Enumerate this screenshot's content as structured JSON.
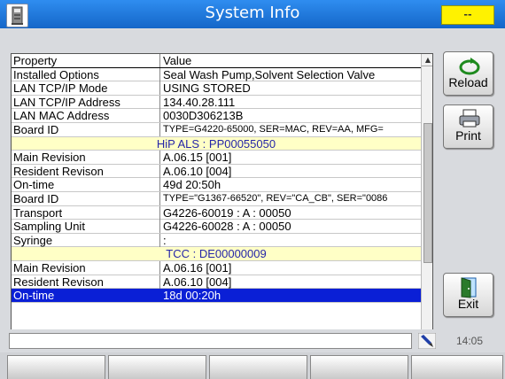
{
  "window": {
    "title": "System Info",
    "status_indicator": "--",
    "accent_color": "#1e74dc",
    "indicator_color": "#fff200"
  },
  "table": {
    "headers": [
      "Property",
      "Value"
    ],
    "rows": [
      {
        "type": "data",
        "property": "Installed Options",
        "value": "Seal Wash Pump,Solvent Selection Valve"
      },
      {
        "type": "data",
        "property": "LAN TCP/IP Mode",
        "value": "USING STORED"
      },
      {
        "type": "data",
        "property": "LAN TCP/IP Address",
        "value": "134.40.28.111"
      },
      {
        "type": "data",
        "property": "LAN MAC Address",
        "value": "0030D306213B"
      },
      {
        "type": "data",
        "property": "Board ID",
        "value": "TYPE=G4220-65000,  SER=MAC,  REV=AA,  MFG=",
        "small": true
      },
      {
        "type": "section",
        "label": "HiP ALS : PP00055050"
      },
      {
        "type": "data",
        "property": "Main Revision",
        "value": "A.06.15 [001]"
      },
      {
        "type": "data",
        "property": "Resident Revison",
        "value": "A.06.10 [004]"
      },
      {
        "type": "data",
        "property": "On-time",
        "value": "49d 20:50h"
      },
      {
        "type": "data",
        "property": "Board ID",
        "value": "TYPE=\"G1367-66520\", REV=\"CA_CB\", SER=\"0086",
        "small": true
      },
      {
        "type": "data",
        "property": "Transport",
        "value": "G4226-60019 : A : 00050"
      },
      {
        "type": "data",
        "property": "Sampling Unit",
        "value": "G4226-60028 : A : 00050"
      },
      {
        "type": "data",
        "property": "Syringe",
        "value": ":"
      },
      {
        "type": "section",
        "label": "TCC : DE00000009"
      },
      {
        "type": "data",
        "property": "Main Revision",
        "value": "A.06.16 [001]"
      },
      {
        "type": "data",
        "property": "Resident Revison",
        "value": "A.06.10 [004]"
      },
      {
        "type": "data",
        "property": "On-time",
        "value": "18d 00:20h",
        "selected": true
      }
    ]
  },
  "buttons": {
    "reload": "Reload",
    "print": "Print",
    "exit": "Exit"
  },
  "statusbar": {
    "message": "",
    "time": "14:05"
  },
  "icons": {
    "app": "instrument-icon",
    "reload": "reload-icon",
    "print": "printer-icon",
    "exit": "exit-door-icon",
    "status": "pen-icon"
  },
  "softkeys": [
    "",
    "",
    "",
    "",
    ""
  ]
}
